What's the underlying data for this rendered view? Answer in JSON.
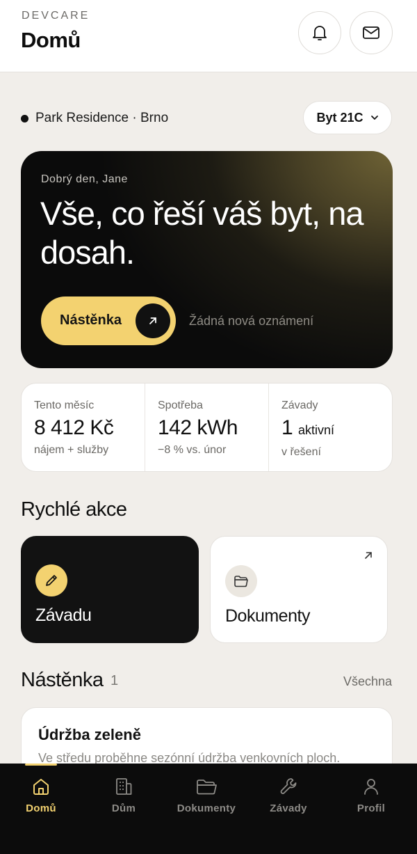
{
  "header": {
    "brand": "DEVCARE",
    "title": "Domů",
    "notifications_icon": "bell-icon",
    "messages_icon": "mail-icon"
  },
  "location": {
    "name": "Park Residence · Brno",
    "unit": "Byt 21C"
  },
  "hero": {
    "greeting": "Dobrý den, Jane",
    "title": "Vše, co řeší váš byt, na dosah.",
    "button_label": "Nástěnka",
    "note": "Žádná nová oznámení"
  },
  "stats": [
    {
      "label": "Tento měsíc",
      "value": "8 412 Kč",
      "unit": "",
      "sub": "nájem + služby"
    },
    {
      "label": "Spotřeba",
      "value": "142 kWh",
      "unit": "",
      "sub": "−8 % vs. únor"
    },
    {
      "label": "Závady",
      "value": "1",
      "unit": "aktivní",
      "sub": "v řešení"
    }
  ],
  "quick_actions": {
    "title": "Rychlé akce",
    "items": [
      {
        "label": "Závadu",
        "icon": "pencil-icon"
      },
      {
        "label": "Dokumenty",
        "icon": "folder-icon"
      }
    ]
  },
  "noticeboard": {
    "title": "Nástěnka",
    "count": "1",
    "all_link": "Všechna",
    "card": {
      "title": "Údržba zeleně",
      "text": "Ve středu proběhne sezónní údržba venkovních ploch."
    }
  },
  "bottom_nav": {
    "active": "Domů",
    "items": [
      {
        "label": "Domů",
        "icon": "home-icon"
      },
      {
        "label": "Dům",
        "icon": "building-icon"
      },
      {
        "label": "Dokumenty",
        "icon": "folder-icon"
      },
      {
        "label": "Závady",
        "icon": "wrench-icon"
      },
      {
        "label": "Profil",
        "icon": "user-icon"
      }
    ]
  },
  "colors": {
    "accent": "#f3d270",
    "background": "#f1eeea",
    "dark": "#121212"
  }
}
